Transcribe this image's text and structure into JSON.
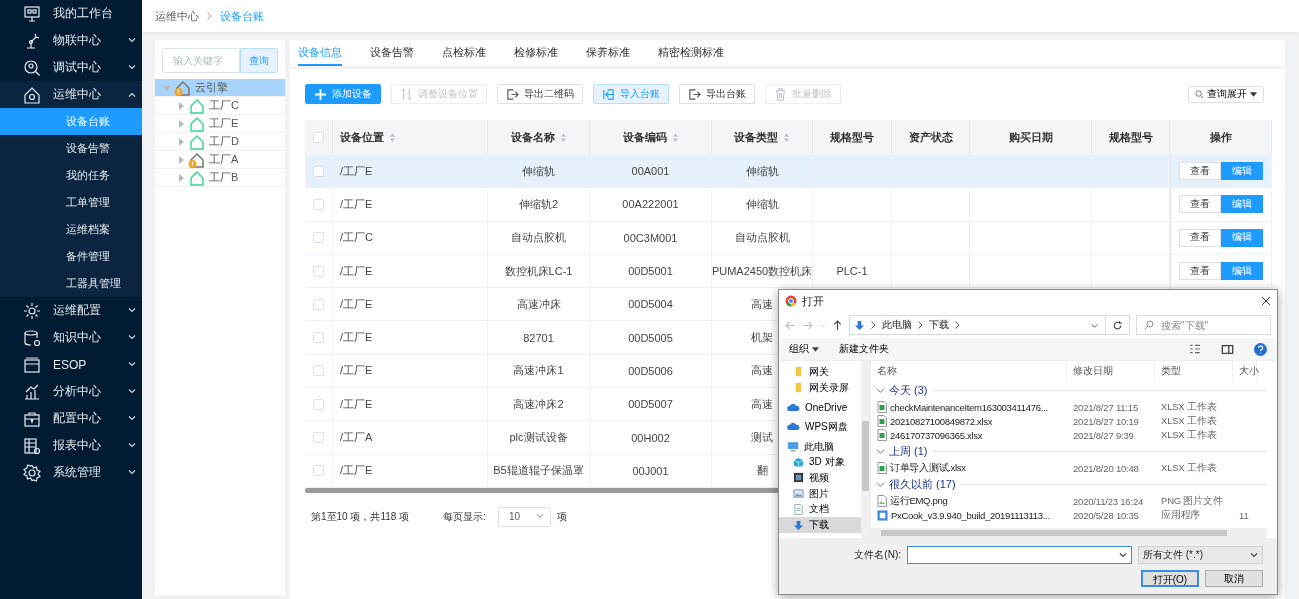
{
  "sidebar": {
    "items": [
      {
        "label": "我的工作台"
      },
      {
        "label": "物联中心",
        "expanded": false
      },
      {
        "label": "调试中心",
        "expanded": false
      },
      {
        "label": "运维中心",
        "expanded": true,
        "children": [
          {
            "label": "设备台账",
            "selected": true
          },
          {
            "label": "设备告警",
            "selected": false
          },
          {
            "label": "我的任务",
            "selected": false
          },
          {
            "label": "工单管理",
            "selected": false
          },
          {
            "label": "运维档案",
            "selected": false
          },
          {
            "label": "备件管理",
            "selected": false
          },
          {
            "label": "工器具管理",
            "selected": false
          }
        ]
      },
      {
        "label": "运维配置",
        "expanded": false
      },
      {
        "label": "知识中心",
        "expanded": false
      },
      {
        "label": "ESOP",
        "expanded": false
      },
      {
        "label": "分析中心",
        "expanded": false
      },
      {
        "label": "配置中心",
        "expanded": false
      },
      {
        "label": "报表中心",
        "expanded": false
      },
      {
        "label": "系统管理",
        "expanded": false
      }
    ]
  },
  "breadcrumb": [
    "运维中心",
    "设备台账"
  ],
  "tree": {
    "search": {
      "placeholder": "输入关键字",
      "button": "查询"
    },
    "nodes": [
      {
        "label": "云引擎",
        "alert": true,
        "expanded": true,
        "selected": true,
        "children": [
          {
            "label": "工厂C",
            "alert": false,
            "expanded": false,
            "selected": false
          },
          {
            "label": "工厂E",
            "alert": false,
            "expanded": false,
            "selected": false
          },
          {
            "label": "工厂D",
            "alert": false,
            "expanded": false,
            "selected": false
          },
          {
            "label": "工厂A",
            "alert": true,
            "expanded": false,
            "selected": false
          },
          {
            "label": "工厂B",
            "alert": false,
            "expanded": false,
            "selected": false
          }
        ]
      }
    ]
  },
  "tabs": [
    {
      "label": "设备信息",
      "selected": true
    },
    {
      "label": "设备告警",
      "selected": false
    },
    {
      "label": "点检标准",
      "selected": false
    },
    {
      "label": "检修标准",
      "selected": false
    },
    {
      "label": "保养标准",
      "selected": false
    },
    {
      "label": "精密检测标准",
      "selected": false
    }
  ],
  "toolbar": [
    {
      "label": "添加设备",
      "kind": "primary",
      "disabled": false
    },
    {
      "label": "调整设备位置",
      "kind": "default",
      "disabled": true
    },
    {
      "label": "导出二维码",
      "kind": "default",
      "disabled": false
    },
    {
      "label": "导入台账",
      "kind": "accent",
      "disabled": false
    },
    {
      "label": "导出台账",
      "kind": "default",
      "disabled": false
    },
    {
      "label": "批量删除",
      "kind": "default",
      "disabled": true
    }
  ],
  "query_toggle": "查询展开",
  "table": {
    "header_checked": false,
    "columns": [
      {
        "label": "设备位置",
        "sortable": true
      },
      {
        "label": "设备名称",
        "sortable": true
      },
      {
        "label": "设备编码",
        "sortable": true
      },
      {
        "label": "设备类型",
        "sortable": true
      },
      {
        "label": "规格型号",
        "sortable": false
      },
      {
        "label": "资产状态",
        "sortable": false
      },
      {
        "label": "购买日期",
        "sortable": false
      },
      {
        "label": "规格型号",
        "sortable": false
      },
      {
        "label": "操作",
        "sortable": false
      }
    ],
    "rows": [
      {
        "selected": true,
        "checked": false,
        "location": "/工厂E",
        "name": "伸缩轨",
        "code": "00A001",
        "type": "伸缩轨",
        "actions": [
          {
            "label": "查看",
            "kind": "default"
          },
          {
            "label": "编辑",
            "kind": "primary"
          }
        ]
      },
      {
        "selected": false,
        "checked": false,
        "location": "/工厂E",
        "name": "伸缩轨2",
        "code": "00A222001",
        "type": "伸缩轨",
        "actions": [
          {
            "label": "查看",
            "kind": "default"
          },
          {
            "label": "编辑",
            "kind": "primary"
          }
        ]
      },
      {
        "selected": false,
        "checked": false,
        "location": "/工厂C",
        "name": "自动点胶机",
        "code": "00C3M001",
        "type": "自动点胶机",
        "actions": [
          {
            "label": "查看",
            "kind": "default"
          },
          {
            "label": "编辑",
            "kind": "primary"
          }
        ]
      },
      {
        "selected": false,
        "checked": false,
        "location": "/工厂E",
        "name": "数控机床LC-1",
        "code": "00D5001",
        "type": "PUMA2450数控机床",
        "model": "PLC-1",
        "actions": [
          {
            "label": "查看",
            "kind": "default"
          },
          {
            "label": "编辑",
            "kind": "primary"
          }
        ]
      },
      {
        "selected": false,
        "checked": false,
        "location": "/工厂E",
        "name": "高速冲床",
        "code": "00D5004",
        "type": "高速"
      },
      {
        "selected": false,
        "checked": false,
        "location": "/工厂E",
        "name": "82701",
        "code": "00D5005",
        "type": "机架"
      },
      {
        "selected": false,
        "checked": false,
        "location": "/工厂E",
        "name": "高速冲床1",
        "code": "00D5006",
        "type": "高速"
      },
      {
        "selected": false,
        "checked": false,
        "location": "/工厂E",
        "name": "高速冲床2",
        "code": "00D5007",
        "type": "高速"
      },
      {
        "selected": false,
        "checked": false,
        "location": "/工厂A",
        "name": "plc测试设备",
        "code": "00H002",
        "type": "测试"
      },
      {
        "selected": false,
        "checked": false,
        "location": "/工厂E",
        "name": "B5辊道辊子保温罩",
        "code": "00J001",
        "type": "翻"
      }
    ]
  },
  "pagination": {
    "summary": "第1至10 项，共118  项",
    "page_size_label": "每页显示:",
    "page_size": "10",
    "unit": "项"
  },
  "dialog": {
    "title": "打开",
    "path": [
      "此电脑",
      "下载"
    ],
    "search": {
      "placeholder": "搜索\"下载\""
    },
    "toolbar": {
      "organize": "组织",
      "new_folder": "新建文件夹"
    },
    "nav": [
      {
        "label": "网关",
        "kind": "folder"
      },
      {
        "label": "网关录屏",
        "kind": "folder"
      },
      {
        "label": "OneDrive",
        "kind": "cloud"
      },
      {
        "label": "WPS网盘",
        "kind": "cloud"
      },
      {
        "label": "此电脑",
        "kind": "computer",
        "selected": false,
        "children": [
          {
            "label": "3D 对象",
            "kind": "cube",
            "selected": false
          },
          {
            "label": "视频",
            "kind": "film",
            "selected": false
          },
          {
            "label": "图片",
            "kind": "picture",
            "selected": false
          },
          {
            "label": "文档",
            "kind": "document",
            "selected": false
          },
          {
            "label": "下载",
            "kind": "download",
            "selected": true
          }
        ]
      }
    ],
    "columns": [
      "名称",
      "修改日期",
      "类型",
      "大小"
    ],
    "groups": [
      {
        "label": "今天 (3)",
        "expanded": true,
        "files": [
          {
            "name": "checkMaintenanceItem163003411476...",
            "date": "2021/8/27 11:15",
            "type": "XLSX 工作表",
            "kind": "sheet"
          },
          {
            "name": "20210827100849872.xlsx",
            "date": "2021/8/27 10:19",
            "type": "XLSX 工作表",
            "kind": "sheet"
          },
          {
            "name": "246170737096365.xlsx",
            "date": "2021/8/27 9:39",
            "type": "XLSX 工作表",
            "kind": "sheet"
          }
        ]
      },
      {
        "label": "上周 (1)",
        "expanded": true,
        "files": [
          {
            "name": "订单导入测试.xlsx",
            "date": "2021/8/20 10:48",
            "type": "XLSX 工作表",
            "kind": "sheet"
          }
        ]
      },
      {
        "label": "很久以前 (17)",
        "expanded": true,
        "files": [
          {
            "name": "运行EMQ.png",
            "date": "2020/11/23 16:24",
            "type": "PNG 图片文件",
            "kind": "image"
          },
          {
            "name": "PxCook_v3.9.940_build_20191113113...",
            "date": "2020/5/28 10:35",
            "type": "应用程序",
            "size": "11",
            "kind": "app"
          }
        ]
      }
    ],
    "filename_label": "文件名(N):",
    "filter": "所有文件 (*.*)",
    "open": "打开(O)",
    "cancel": "取消"
  }
}
